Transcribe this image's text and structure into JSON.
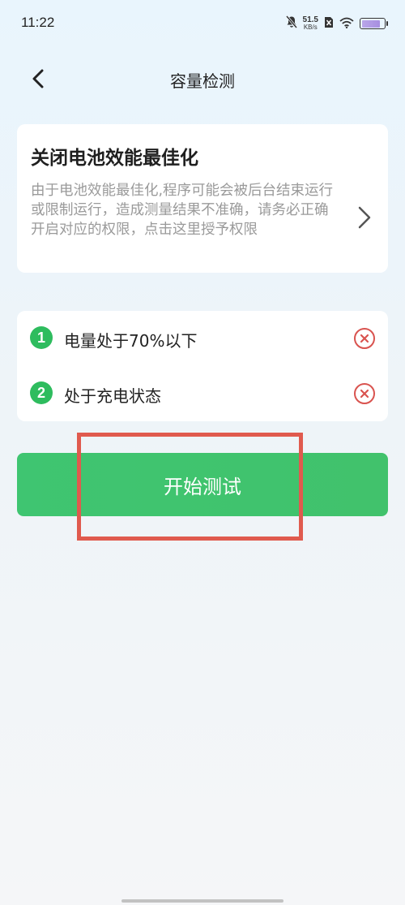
{
  "status_bar": {
    "time": "11:22",
    "net_speed_value": "51.5",
    "net_speed_unit": "KB/s",
    "icons": [
      "mute-bell-icon",
      "no-sim-icon",
      "wifi-icon",
      "battery-icon"
    ],
    "battery_level": 0.85
  },
  "header": {
    "title": "容量检测",
    "back_icon": "chevron-left-icon"
  },
  "permission_card": {
    "title": "关闭电池效能最佳化",
    "description": "由于电池效能最佳化,程序可能会被后台结束运行或限制运行，造成测量结果不准确，请务必正确开启对应的权限，点击这里授予权限",
    "arrow_icon": "chevron-right-icon"
  },
  "conditions": [
    {
      "number": "1",
      "label": "电量处于70%以下",
      "status": "not-met",
      "status_icon": "x-circle-icon"
    },
    {
      "number": "2",
      "label": "处于充电状态",
      "status": "not-met",
      "status_icon": "x-circle-icon"
    }
  ],
  "start_button": {
    "label": "开始测试"
  },
  "colors": {
    "accent_green": "#3fc571",
    "badge_green": "#2ebc5e",
    "error_red": "#d9534f",
    "highlight_red": "#e05a4e",
    "muted_text": "#9a9a9a"
  }
}
